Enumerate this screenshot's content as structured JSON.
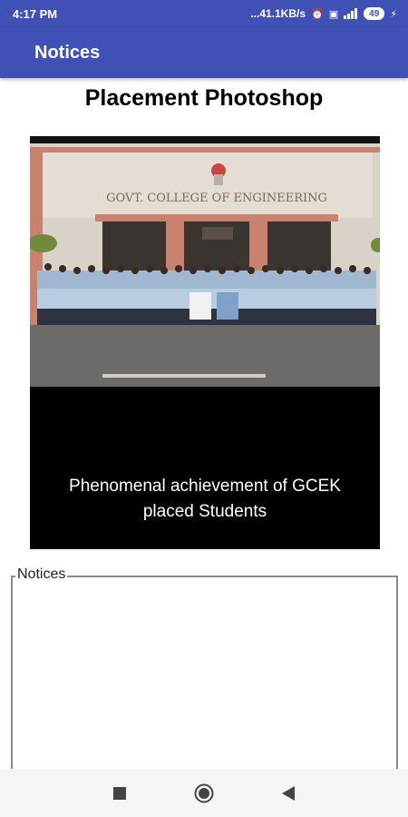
{
  "status_bar": {
    "time": "4:17 PM",
    "network_speed": "...41.1KB/s",
    "battery_level": "49"
  },
  "app_bar": {
    "title": "Notices"
  },
  "main": {
    "heading": "Placement Photoshop",
    "photo": {
      "building_sign": "GOVT. COLLEGE OF ENGINEERING",
      "caption_line1": "Phenomenal achievement of GCEK",
      "caption_line2": "placed Students"
    },
    "notices_group": {
      "legend": "Notices"
    }
  },
  "colors": {
    "app_bar": "#3f51b5",
    "background": "#ffffff",
    "card": "#000000"
  },
  "icons": [
    "wifi-icon",
    "signal-icon",
    "battery-icon",
    "recent-apps-icon",
    "home-icon",
    "back-icon"
  ]
}
